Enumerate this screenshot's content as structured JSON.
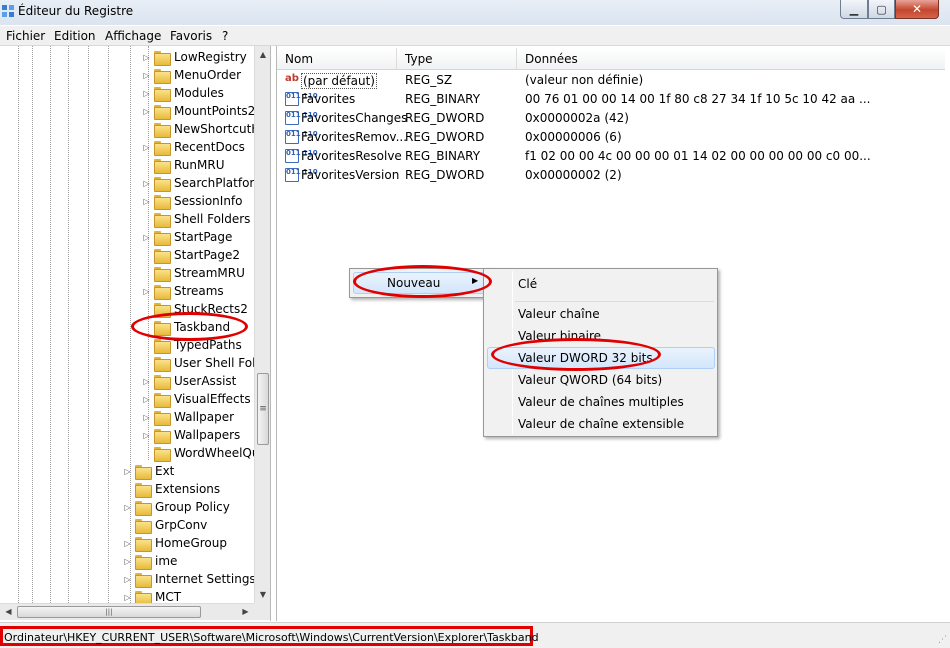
{
  "window": {
    "title": "Éditeur du Registre",
    "min_glyph": "▁",
    "max_glyph": "▢",
    "close_glyph": "✕",
    "accent_close": "#c4462e"
  },
  "menubar": {
    "items": [
      "Fichier",
      "Edition",
      "Affichage",
      "Favoris",
      "?"
    ]
  },
  "tree": {
    "items": [
      {
        "label": "LowRegistry",
        "expandable": true
      },
      {
        "label": "MenuOrder",
        "expandable": true
      },
      {
        "label": "Modules",
        "expandable": true
      },
      {
        "label": "MountPoints2",
        "expandable": true
      },
      {
        "label": "NewShortcutH",
        "expandable": false
      },
      {
        "label": "RecentDocs",
        "expandable": true
      },
      {
        "label": "RunMRU",
        "expandable": false
      },
      {
        "label": "SearchPlatform",
        "expandable": true
      },
      {
        "label": "SessionInfo",
        "expandable": true
      },
      {
        "label": "Shell Folders",
        "expandable": false
      },
      {
        "label": "StartPage",
        "expandable": true
      },
      {
        "label": "StartPage2",
        "expandable": false
      },
      {
        "label": "StreamMRU",
        "expandable": false
      },
      {
        "label": "Streams",
        "expandable": true
      },
      {
        "label": "StuckRects2",
        "expandable": false
      },
      {
        "label": "Taskband",
        "expandable": false
      },
      {
        "label": "TypedPaths",
        "expandable": false
      },
      {
        "label": "User Shell Fold",
        "expandable": false
      },
      {
        "label": "UserAssist",
        "expandable": true
      },
      {
        "label": "VisualEffects",
        "expandable": true
      },
      {
        "label": "Wallpaper",
        "expandable": true
      },
      {
        "label": "Wallpapers",
        "expandable": true
      },
      {
        "label": "WordWheelQu",
        "expandable": false
      },
      {
        "label": "Ext",
        "expandable": true
      },
      {
        "label": "Extensions",
        "expandable": false
      },
      {
        "label": "Group Policy",
        "expandable": true
      },
      {
        "label": "GrpConv",
        "expandable": false
      },
      {
        "label": "HomeGroup",
        "expandable": true
      },
      {
        "label": "ime",
        "expandable": true
      },
      {
        "label": "Internet Settings",
        "expandable": true
      },
      {
        "label": "MCT",
        "expandable": true
      }
    ],
    "expand_glyph": "▷",
    "scroll_up": "▲",
    "scroll_down": "▼",
    "scroll_left": "◀",
    "scroll_right": "▶",
    "grip": "≡",
    "hgrip": "|||"
  },
  "list": {
    "columns": [
      "Nom",
      "Type",
      "Données"
    ],
    "rows": [
      {
        "icon": "string-value-icon",
        "name": "(par défaut)",
        "type": "REG_SZ",
        "data": "(valeur non définie)"
      },
      {
        "icon": "binary-value-icon",
        "name": "Favorites",
        "type": "REG_BINARY",
        "data": "00 76 01 00 00 14 00 1f 80 c8 27 34 1f 10 5c 10 42 aa ..."
      },
      {
        "icon": "binary-value-icon",
        "name": "FavoritesChanges",
        "type": "REG_DWORD",
        "data": "0x0000002a (42)"
      },
      {
        "icon": "binary-value-icon",
        "name": "FavoritesRemov...",
        "type": "REG_DWORD",
        "data": "0x00000006 (6)"
      },
      {
        "icon": "binary-value-icon",
        "name": "FavoritesResolve",
        "type": "REG_BINARY",
        "data": "f1 02 00 00 4c 00 00 00 01 14 02 00 00 00 00 00 c0 00..."
      },
      {
        "icon": "binary-value-icon",
        "name": "FavoritesVersion",
        "type": "REG_DWORD",
        "data": "0x00000002 (2)"
      }
    ],
    "ab_glyph": "ab",
    "bin_glyph": "011 110"
  },
  "context_menu": {
    "parent_label": "Nouveau",
    "parent_arrow": "▶",
    "items": [
      "Clé",
      "Valeur chaîne",
      "Valeur binaire",
      "Valeur DWORD 32 bits",
      "Valeur QWORD (64 bits)",
      "Valeur de chaînes multiples",
      "Valeur de chaîne extensible"
    ],
    "highlighted": "Valeur DWORD 32 bits"
  },
  "statusbar": {
    "path": "Ordinateur\\HKEY_CURRENT_USER\\Software\\Microsoft\\Windows\\CurrentVersion\\Explorer\\Taskband",
    "grip": "⋰"
  },
  "annotation_color": "#e00000"
}
